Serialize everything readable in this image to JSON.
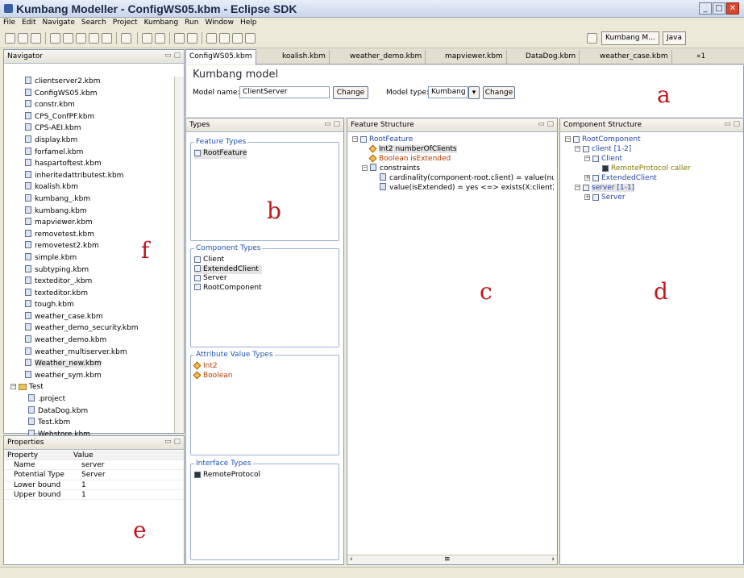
{
  "window": {
    "title": "Kumbang Modeller - ConfigWS05.kbm - Eclipse SDK",
    "controls": {
      "minimize": "_",
      "maximize": "□",
      "close": "✕"
    }
  },
  "menu": [
    "File",
    "Edit",
    "Navigate",
    "Search",
    "Project",
    "Kumbang",
    "Run",
    "Window",
    "Help"
  ],
  "perspectives": {
    "kumbang": "Kumbang M...",
    "java": "Java"
  },
  "navigator": {
    "title": "Navigator",
    "files": [
      "clientserver2.kbm",
      "ConfigWS05.kbm",
      "constr.kbm",
      "CPS_ConfPF.kbm",
      "CPS-AEI.kbm",
      "display.kbm",
      "forfamel.kbm",
      "haspartoftest.kbm",
      "inheritedattributest.kbm",
      "koalish.kbm",
      "kumbang_.kbm",
      "kumbang.kbm",
      "mapviewer.kbm",
      "removetest.kbm",
      "removetest2.kbm",
      "simple.kbm",
      "subtyping.kbm",
      "texteditor_.kbm",
      "texteditor.kbm",
      "tough.kbm",
      "weather_case.kbm",
      "weather_demo_security.kbm",
      "weather_demo.kbm",
      "weather_multiserver.kbm",
      "Weather_new.kbm",
      "weather_sym.kbm"
    ],
    "selected_file": "Weather_new.kbm",
    "test_folder": "Test",
    "test_files": [
      ".project",
      "DataDog.kbm",
      "Test.kbm",
      "Webstore.kbm"
    ]
  },
  "properties": {
    "title": "Properties",
    "headers": {
      "property": "Property",
      "value": "Value"
    },
    "rows": [
      {
        "property": "Name",
        "value": "server"
      },
      {
        "property": "Potential Type",
        "value": "Server"
      },
      {
        "property": "Lower bound",
        "value": "1"
      },
      {
        "property": "Upper bound",
        "value": "1"
      }
    ]
  },
  "editor_tabs": [
    "ConfigWS05.kbm",
    "koalish.kbm",
    "weather_demo.kbm",
    "mapviewer.kbm",
    "DataDog.kbm",
    "weather_case.kbm"
  ],
  "editor_tab_overflow": "»1",
  "editor": {
    "heading": "Kumbang model",
    "model_name_label": "Model name:",
    "model_name_value": "ClientServer",
    "change_label": "Change",
    "model_type_label": "Model type:",
    "model_type_value": "Kumbang"
  },
  "types": {
    "title": "Types",
    "feature_types": {
      "title": "Feature Types",
      "items": [
        "RootFeature"
      ]
    },
    "component_types": {
      "title": "Component Types",
      "items": [
        "Client",
        "ExtendedClient",
        "Server",
        "RootComponent"
      ]
    },
    "attribute_value_types": {
      "title": "Attribute Value Types",
      "items": [
        "Int2",
        "Boolean"
      ]
    },
    "interface_types": {
      "title": "Interface Types",
      "items": [
        "RemoteProtocol"
      ]
    }
  },
  "feature_structure": {
    "title": "Feature Structure",
    "root": "RootFeature",
    "attr1": "Int2 numberOfClients",
    "attr2": "Boolean isExtended",
    "constraints": "constraints",
    "c1": "cardinality(component-root.client) = value(num",
    "c2": "value(isExtended) = yes <=> exists(X:client) (r"
  },
  "component_structure": {
    "title": "Component Structure",
    "root": "RootComponent",
    "client_part": "client [1-2]",
    "client": "Client",
    "remote": "RemoteProtocol caller",
    "extended_client": "ExtendedClient",
    "server_part": "server [1-1]",
    "server": "Server"
  },
  "annotations": {
    "a": "a",
    "b": "b",
    "c": "c",
    "d": "d",
    "e": "e",
    "f": "f"
  },
  "colors": {
    "annotation": "#c0171d",
    "group_title": "#1f56b3",
    "link_blue": "#2346a6",
    "olive_text": "#8a7a00",
    "attr_red": "#b23b00"
  }
}
